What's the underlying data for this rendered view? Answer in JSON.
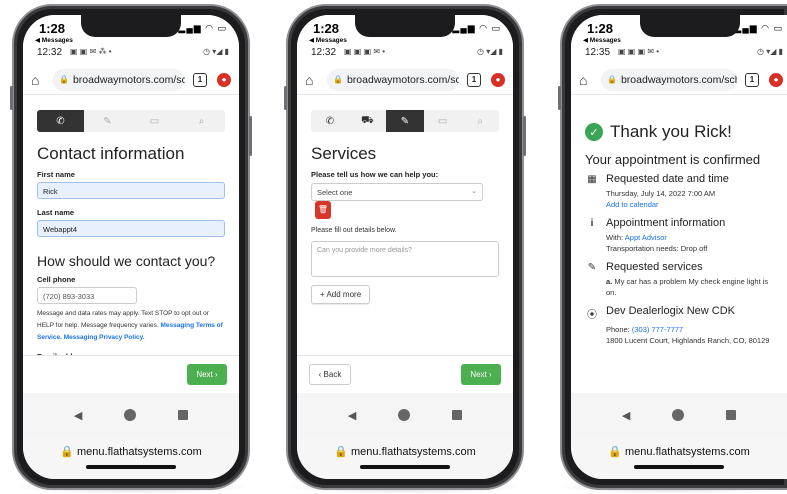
{
  "phone1": {
    "ios_time": "1:28",
    "ios_back": "◀ Messages",
    "android_time": "12:32",
    "url": "broadwaymotors.com/sched",
    "tabs_count": "1",
    "title": "Contact information",
    "first_name_label": "First name",
    "first_name_value": "Rick",
    "last_name_label": "Last name",
    "last_name_value": "Webappt4",
    "contact_heading": "How should we contact you?",
    "cell_label": "Cell phone",
    "cell_placeholder": "(720) 893-3033",
    "disclaimer": "Message and data rates may apply. Text STOP to opt out or HELP for help. Message frequency varies.",
    "terms_link": "Messaging Terms of Service.",
    "privacy_link": "Messaging Privacy Policy.",
    "email_label": "Email address",
    "next_label": "Next",
    "bottom_url": "menu.flathatsystems.com"
  },
  "phone2": {
    "ios_time": "1:28",
    "ios_back": "◀ Messages",
    "android_time": "12:32",
    "url": "broadwaymotors.com/sched",
    "tabs_count": "1",
    "title": "Services",
    "help_label": "Please tell us how we can help you:",
    "select_value": "Select one",
    "details_label": "Please fill out details below.",
    "details_placeholder": "Can you provide more details?",
    "add_more_label": "Add more",
    "back_label": "Back",
    "next_label": "Next",
    "bottom_url": "menu.flathatsystems.com"
  },
  "phone3": {
    "ios_time": "1:28",
    "ios_back": "◀ Messages",
    "android_time": "12:35",
    "url": "broadwaymotors.com/sched",
    "tabs_count": "1",
    "thanks": "Thank you Rick!",
    "confirmed": "Your appointment is confirmed",
    "date_title": "Requested date and time",
    "date_value": "Thursday, July 14, 2022 7:00 AM",
    "add_calendar": "Add to calendar",
    "appt_title": "Appointment information",
    "with_label": "With:",
    "with_value": "Appt Advisor",
    "transport": "Transportation needs: Drop off",
    "services_title": "Requested services",
    "service_prefix": "a.",
    "service_text": "My car has a problem My check engine light is on.",
    "dealer_title": "Dev Dealerlogix New CDK",
    "phone_label": "Phone:",
    "phone_value": "(303) 777-7777",
    "address": "1800 Lucent Court, Highlands Ranch, CO, 80129",
    "bottom_url": "menu.flathatsystems.com"
  },
  "colors": {
    "accent": "#4caf50",
    "link": "#1a73e8",
    "danger": "#d9362b",
    "success": "#3aa655"
  }
}
